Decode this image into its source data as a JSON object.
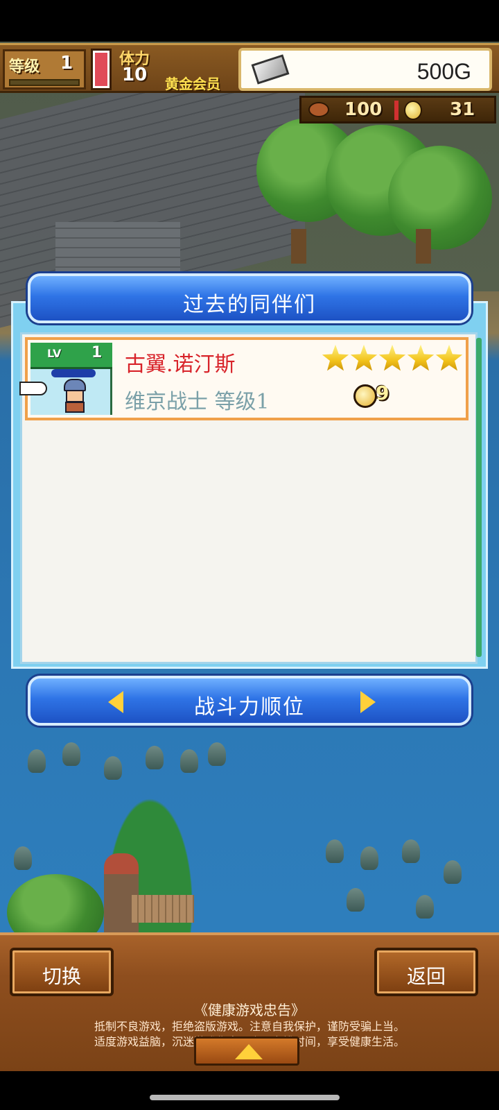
{
  "top_bar": {
    "level_label": "等级",
    "level_value": "1",
    "stamina_label": "体力",
    "stamina_value": "10",
    "membership": "黄金会员",
    "money": "500G"
  },
  "resources": {
    "meat": "100",
    "coins": "31"
  },
  "dialog": {
    "title": "过去的同伴们",
    "entries": [
      {
        "level_tag": "LV",
        "level": "1",
        "name": "古翼.诺汀斯",
        "class_level": "维京战士 等级1",
        "stars": 5,
        "cost": "9"
      }
    ],
    "sort_label": "战斗力顺位"
  },
  "bottom": {
    "switch_label": "切换",
    "back_label": "返回",
    "advice_title": "《健康游戏忠告》",
    "advice_line1": "抵制不良游戏，拒绝盗版游戏。注意自我保护，谨防受骗上当。",
    "advice_line2": "适度游戏益脑，沉迷游戏伤身。合理安排时间，享受健康生活。"
  },
  "colors": {
    "name_red": "#d8232a",
    "class_gray": "#7aa0a8",
    "banner_blue": "#2f74e6",
    "panel_cyan": "#7fd0f0",
    "row_border": "#f0a04a"
  }
}
